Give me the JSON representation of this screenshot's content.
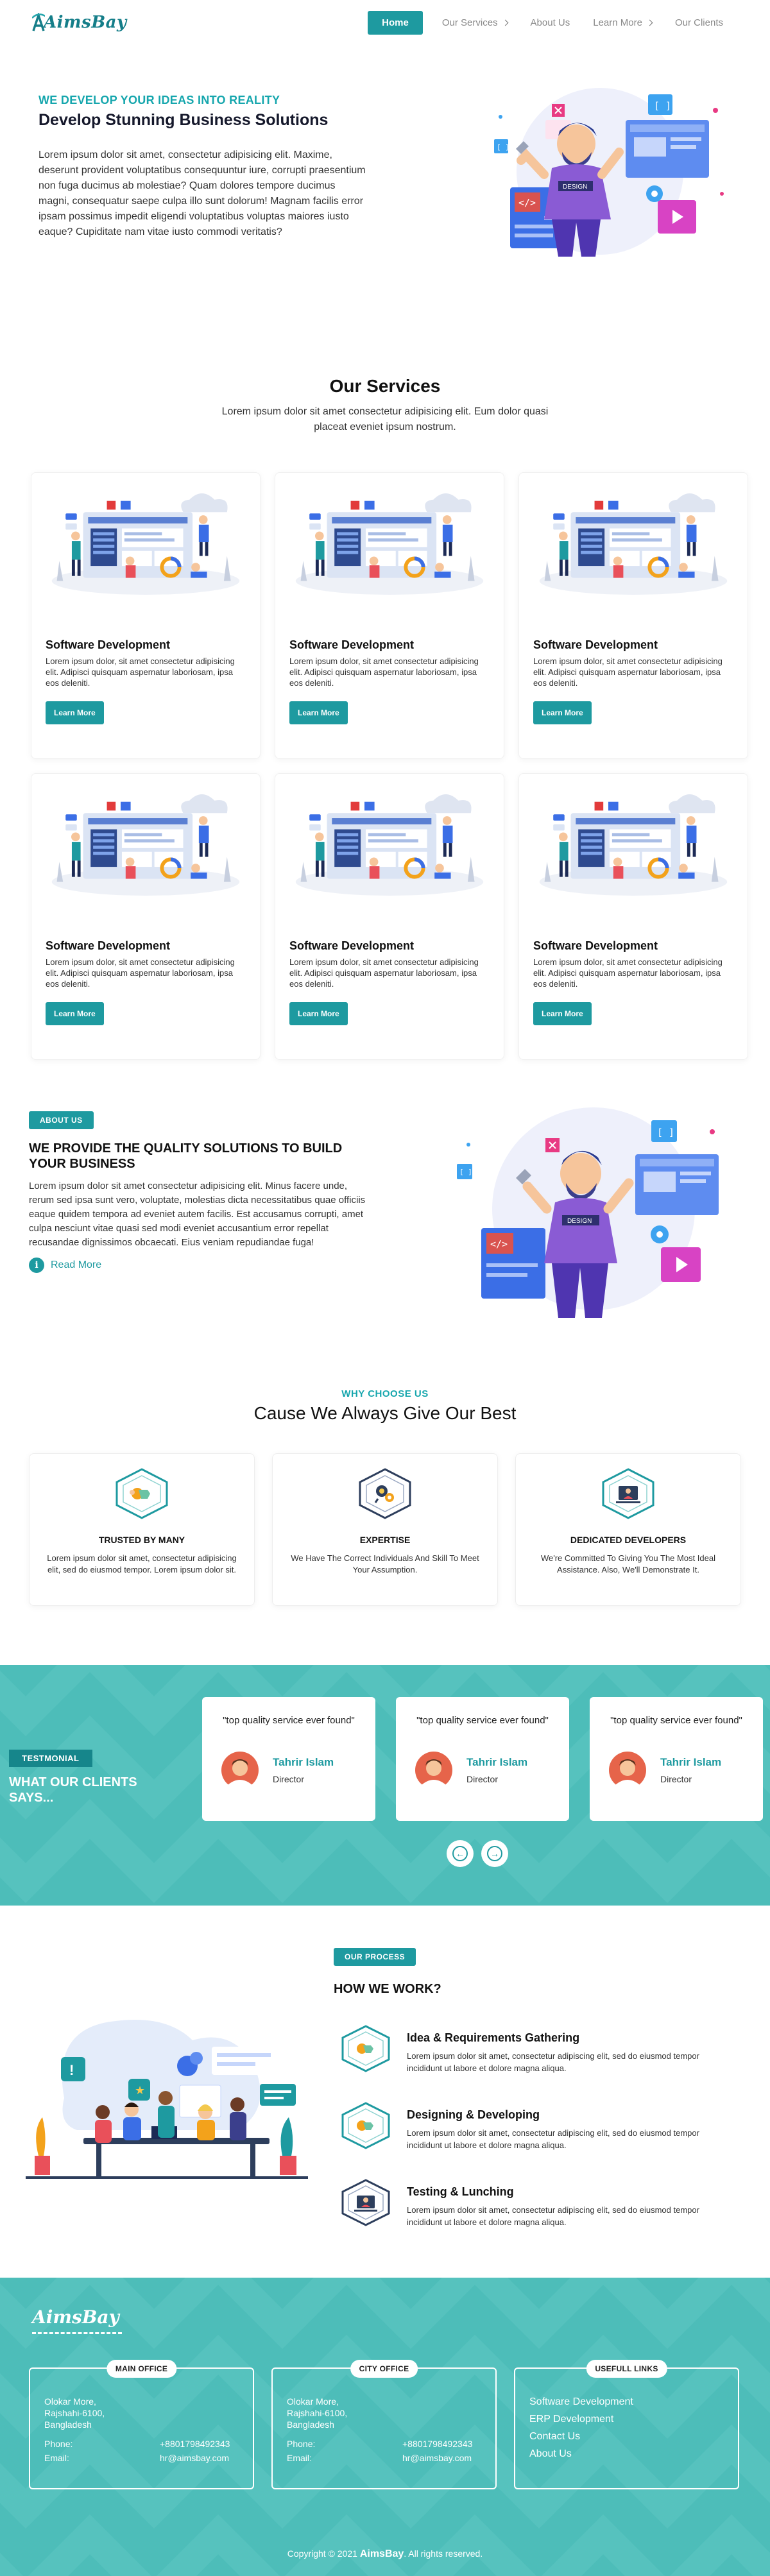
{
  "brand": {
    "name": "AimsBay",
    "accent": "#1e9aa0",
    "teal_bg": "#4dbdb9"
  },
  "nav": {
    "items": [
      {
        "label": "Home",
        "active": true
      },
      {
        "label": "Our Services",
        "dropdown": true
      },
      {
        "label": "About Us"
      },
      {
        "label": "Learn More",
        "dropdown": true
      },
      {
        "label": "Our Clients"
      }
    ]
  },
  "hero": {
    "eyebrow": "WE DEVELOP YOUR IDEAS INTO REALITY",
    "title": "Develop Stunning Business Solutions",
    "body": "Lorem ipsum dolor sit amet, consectetur adipisicing elit. Maxime, deserunt provident voluptatibus consequuntur iure, corrupti praesentium non fuga ducimus ab molestiae? Quam dolores tempore ducimus magni, consequatur saepe culpa illo sunt dolorum! Magnam facilis error ipsam possimus impedit eligendi voluptatibus voluptas maiores iusto eaque? Cupiditate nam vitae iusto commodi veritatis?",
    "art_text": "DESIGN"
  },
  "services": {
    "title": "Our Services",
    "subtitle": "Lorem ipsum dolor sit amet consectetur adipisicing elit. Eum dolor quasi placeat eveniet ipsum nostrum.",
    "cards": [
      {
        "title": "Software Development",
        "body": "Lorem ipsum dolor, sit amet consectetur adipisicing elit. Adipisci quisquam aspernatur laboriosam, ipsa eos deleniti.",
        "button": "Learn More"
      },
      {
        "title": "Software Development",
        "body": "Lorem ipsum dolor, sit amet consectetur adipisicing elit. Adipisci quisquam aspernatur laboriosam, ipsa eos deleniti.",
        "button": "Learn More"
      },
      {
        "title": "Software Development",
        "body": "Lorem ipsum dolor, sit amet consectetur adipisicing elit. Adipisci quisquam aspernatur laboriosam, ipsa eos deleniti.",
        "button": "Learn More"
      },
      {
        "title": "Software Development",
        "body": "Lorem ipsum dolor, sit amet consectetur adipisicing elit. Adipisci quisquam aspernatur laboriosam, ipsa eos deleniti.",
        "button": "Learn More"
      },
      {
        "title": "Software Development",
        "body": "Lorem ipsum dolor, sit amet consectetur adipisicing elit. Adipisci quisquam aspernatur laboriosam, ipsa eos deleniti.",
        "button": "Learn More"
      },
      {
        "title": "Software Development",
        "body": "Lorem ipsum dolor, sit amet consectetur adipisicing elit. Adipisci quisquam aspernatur laboriosam, ipsa eos deleniti.",
        "button": "Learn More"
      }
    ]
  },
  "about": {
    "tag": "ABOUT US",
    "title": "WE PROVIDE THE QUALITY SOLUTIONS TO BUILD YOUR BUSINESS",
    "body": "Lorem ipsum dolor sit amet consectetur adipisicing elit. Minus facere unde, rerum sed ipsa sunt vero, voluptate, molestias dicta necessitatibus quae officiis eaque quidem tempora ad eveniet autem facilis. Est accusamus corrupti, amet culpa nesciunt vitae quasi sed modi eveniet accusantium error repellat recusandae dignissimos obcaecati. Eius veniam repudiandae fuga!",
    "read_more": "Read More",
    "info_icon": "i"
  },
  "why": {
    "eyebrow": "WHY CHOOSE US",
    "title": "Cause We Always Give Our Best",
    "cards": [
      {
        "title": "TRUSTED BY MANY",
        "body": "Lorem ipsum dolor sit amet, consectetur adipisicing elit, sed do eiusmod tempor. Lorem ipsum dolor sit.",
        "icon": "handshake-icon"
      },
      {
        "title": "EXPERTISE",
        "body": "We Have The Correct Individuals And Skill To Meet Your Assumption.",
        "icon": "expertise-icon"
      },
      {
        "title": "DEDICATED DEVELOPERS",
        "body": "We're Committed To Giving You The Most Ideal Assistance. Also, We'll Demonstrate It.",
        "icon": "developer-icon"
      }
    ]
  },
  "testimonials": {
    "tag": "TESTMONIAL",
    "title": "WHAT OUR CLIENTS SAYS...",
    "items": [
      {
        "quote": "\"top quality service ever found\"",
        "name": "Tahrir Islam",
        "role": "Director"
      },
      {
        "quote": "\"top quality service ever found\"",
        "name": "Tahrir Islam",
        "role": "Director"
      },
      {
        "quote": "\"top quality service ever found\"",
        "name": "Tahrir Islam",
        "role": "Director"
      }
    ]
  },
  "process": {
    "tag": "OUR PROCESS",
    "title": "HOW WE WORK?",
    "steps": [
      {
        "title": "Idea & Requirements Gathering",
        "body": "Lorem ipsum dolor sit amet, consectetur adipiscing elit, sed do eiusmod tempor incididunt ut labore et dolore magna aliqua."
      },
      {
        "title": "Designing & Developing",
        "body": "Lorem ipsum dolor sit amet, consectetur adipiscing elit, sed do eiusmod tempor incididunt ut labore et dolore magna aliqua."
      },
      {
        "title": "Testing & Lunching",
        "body": "Lorem ipsum dolor sit amet, consectetur adipiscing elit, sed do eiusmod tempor incididunt ut labore et dolore magna aliqua."
      }
    ]
  },
  "footer": {
    "main_office": {
      "title": "MAIN OFFICE",
      "address": [
        "Olokar More,",
        "Rajshahi-6100,",
        "Bangladesh"
      ],
      "phone_label": "Phone:",
      "phone": "+8801798492343",
      "email_label": "Email:",
      "email": "hr@aimsbay.com"
    },
    "city_office": {
      "title": "CITY OFFICE",
      "address": [
        "Olokar More,",
        "Rajshahi-6100,",
        "Bangladesh"
      ],
      "phone_label": "Phone:",
      "phone": "+8801798492343",
      "email_label": "Email:",
      "email": "hr@aimsbay.com"
    },
    "useful_links": {
      "title": "USEFULL LINKS",
      "links": [
        "Software Development",
        "ERP Development",
        "Contact Us",
        "About Us"
      ]
    },
    "copyright_prefix": "Copyright © 2021",
    "copyright_brand": "AimsBay",
    "copyright_suffix": ". All rights reserved."
  }
}
